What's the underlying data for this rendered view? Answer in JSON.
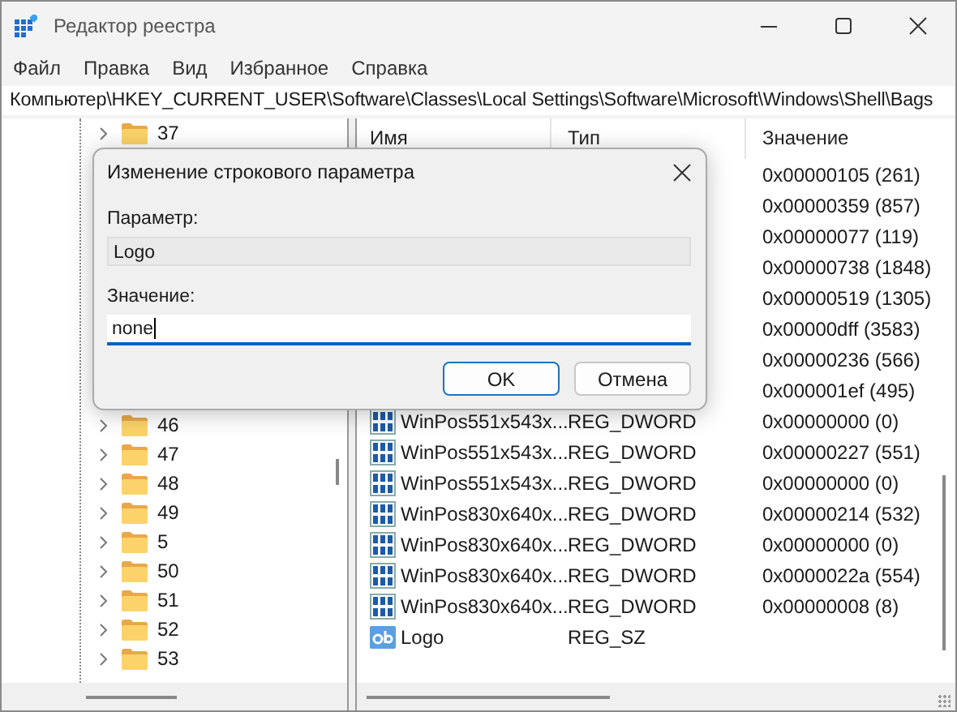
{
  "window": {
    "title": "Редактор реестра"
  },
  "menu": [
    "Файл",
    "Правка",
    "Вид",
    "Избранное",
    "Справка"
  ],
  "address": "Компьютер\\HKEY_CURRENT_USER\\Software\\Classes\\Local Settings\\Software\\Microsoft\\Windows\\Shell\\Bags",
  "tree": {
    "items_before": [
      "37"
    ],
    "items_after": [
      "46",
      "47",
      "48",
      "49",
      "5",
      "50",
      "51",
      "52",
      "53"
    ]
  },
  "list": {
    "columns": [
      "Имя",
      "Тип",
      "Значение"
    ],
    "rows": [
      {
        "value": "0x00000105 (261)"
      },
      {
        "value": "0x00000359 (857)"
      },
      {
        "value": "0x00000077 (119)"
      },
      {
        "value": "0x00000738 (1848)"
      },
      {
        "value": "0x00000519 (1305)"
      },
      {
        "value": "0x00000dff (3583)"
      },
      {
        "value": "0x00000236 (566)"
      },
      {
        "value": "0x000001ef (495)"
      },
      {
        "kind": "dword",
        "name": "WinPos551x543x...",
        "type": "REG_DWORD",
        "value": "0x00000000 (0)"
      },
      {
        "kind": "dword",
        "name": "WinPos551x543x...",
        "type": "REG_DWORD",
        "value": "0x00000227 (551)"
      },
      {
        "kind": "dword",
        "name": "WinPos551x543x...",
        "type": "REG_DWORD",
        "value": "0x00000000 (0)"
      },
      {
        "kind": "dword",
        "name": "WinPos830x640x...",
        "type": "REG_DWORD",
        "value": "0x00000214 (532)"
      },
      {
        "kind": "dword",
        "name": "WinPos830x640x...",
        "type": "REG_DWORD",
        "value": "0x00000000 (0)"
      },
      {
        "kind": "dword",
        "name": "WinPos830x640x...",
        "type": "REG_DWORD",
        "value": "0x0000022a (554)"
      },
      {
        "kind": "dword",
        "name": "WinPos830x640x...",
        "type": "REG_DWORD",
        "value": "0x00000008 (8)"
      },
      {
        "kind": "string",
        "name": "Logo",
        "type": "REG_SZ"
      }
    ]
  },
  "dialog": {
    "title": "Изменение строкового параметра",
    "name_label": "Параметр:",
    "name_value": "Logo",
    "value_label": "Значение:",
    "value": "none",
    "buttons": [
      "OK",
      "Отмена"
    ]
  }
}
